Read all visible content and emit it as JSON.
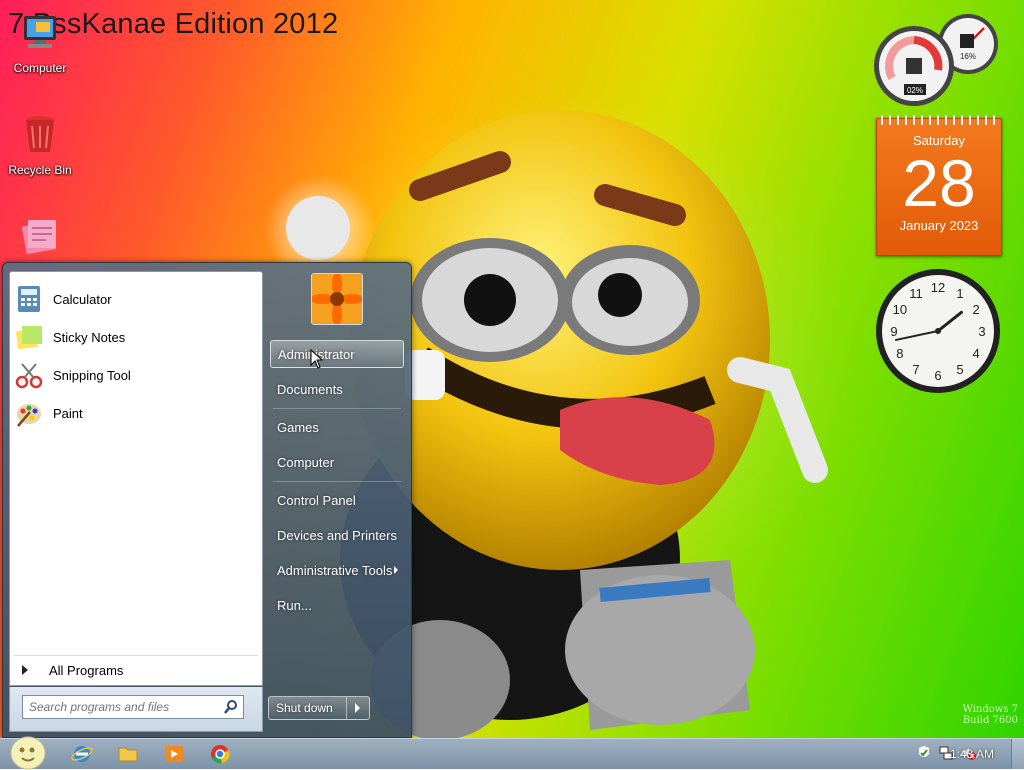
{
  "os_title": "7 BssKanae Edition 2012",
  "desktop_icons": [
    {
      "label": "Computer",
      "icon": "computer-icon"
    },
    {
      "label": "Recycle Bin",
      "icon": "recycle-bin-icon"
    },
    {
      "label": "",
      "icon": "notes-icon"
    }
  ],
  "gadgets": {
    "cpu_meter": {
      "cpu": "02%",
      "memory": "16%"
    },
    "calendar": {
      "weekday": "Saturday",
      "day": "28",
      "month_year": "January 2023"
    },
    "clock": {
      "hour": 1,
      "minute": 43
    }
  },
  "start_menu": {
    "programs": [
      {
        "label": "Calculator",
        "icon": "calculator-icon"
      },
      {
        "label": "Sticky Notes",
        "icon": "sticky-notes-icon"
      },
      {
        "label": "Snipping Tool",
        "icon": "snipping-tool-icon"
      },
      {
        "label": "Paint",
        "icon": "paint-icon"
      }
    ],
    "all_programs": "All Programs",
    "search_placeholder": "Search programs and files",
    "right_items": [
      {
        "label": "Administrator"
      },
      {
        "label": "Documents"
      },
      {
        "label": "Games"
      },
      {
        "label": "Computer"
      },
      {
        "label": "Control Panel"
      },
      {
        "label": "Devices and Printers"
      },
      {
        "label": "Administrative Tools"
      },
      {
        "label": "Run..."
      }
    ],
    "shutdown_label": "Shut down"
  },
  "watermark": {
    "line1": "Windows 7",
    "line2": "Build 7600"
  },
  "taskbar": {
    "pinned": [
      "internet-explorer-icon",
      "folder-icon",
      "media-player-icon",
      "chrome-icon"
    ],
    "tray": [
      "action-center-icon",
      "network-icon",
      "volume-muted-icon"
    ],
    "time": "1:43 AM"
  }
}
